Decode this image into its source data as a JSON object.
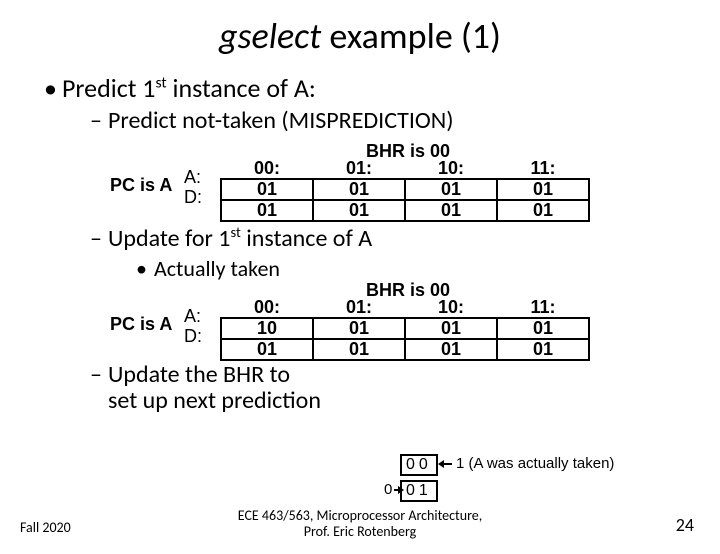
{
  "title": {
    "word": "gselect",
    "rest": " example (1)"
  },
  "lvl1": {
    "pre": "Predict 1",
    "sup": "st",
    "post": " instance of A:"
  },
  "sub1": "Predict not-taken (MISPREDICTION)",
  "table_labels": {
    "pc": "PC is A",
    "rows": [
      "A:",
      "D:"
    ],
    "bhr_caption": "BHR is 00",
    "cols": [
      "00:",
      "01:",
      "10:",
      "11:"
    ]
  },
  "table1": {
    "A": [
      "01",
      "01",
      "01",
      "01"
    ],
    "D": [
      "01",
      "01",
      "01",
      "01"
    ]
  },
  "sub2": {
    "pre": "Update for 1",
    "sup": "st",
    "post": " instance of A"
  },
  "sub2a": "Actually taken",
  "table2": {
    "A": [
      "10",
      "01",
      "01",
      "01"
    ],
    "D": [
      "01",
      "01",
      "01",
      "01"
    ]
  },
  "sub3a": "Update the BHR to",
  "sub3b": "set up next prediction",
  "bhr": {
    "old": "00",
    "note": "1 (A was actually taken)",
    "shift_in": "0",
    "new": "01"
  },
  "footer": {
    "left": "Fall 2020",
    "center1": "ECE 463/563, Microprocessor Architecture,",
    "center2": "Prof. Eric Rotenberg",
    "right": "24"
  }
}
